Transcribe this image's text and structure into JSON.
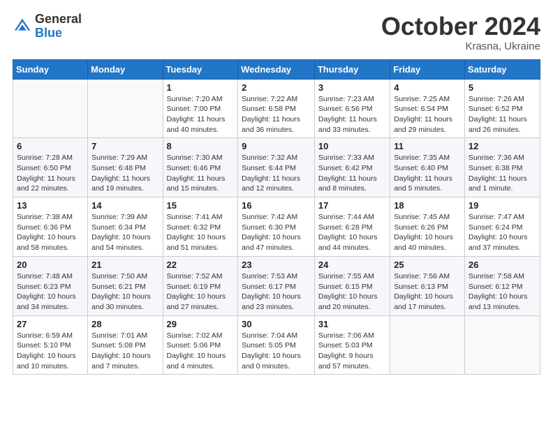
{
  "header": {
    "logo_general": "General",
    "logo_blue": "Blue",
    "title": "October 2024",
    "location": "Krasna, Ukraine"
  },
  "weekdays": [
    "Sunday",
    "Monday",
    "Tuesday",
    "Wednesday",
    "Thursday",
    "Friday",
    "Saturday"
  ],
  "weeks": [
    [
      {
        "day": "",
        "sunrise": "",
        "sunset": "",
        "daylight": ""
      },
      {
        "day": "",
        "sunrise": "",
        "sunset": "",
        "daylight": ""
      },
      {
        "day": "1",
        "sunrise": "Sunrise: 7:20 AM",
        "sunset": "Sunset: 7:00 PM",
        "daylight": "Daylight: 11 hours and 40 minutes."
      },
      {
        "day": "2",
        "sunrise": "Sunrise: 7:22 AM",
        "sunset": "Sunset: 6:58 PM",
        "daylight": "Daylight: 11 hours and 36 minutes."
      },
      {
        "day": "3",
        "sunrise": "Sunrise: 7:23 AM",
        "sunset": "Sunset: 6:56 PM",
        "daylight": "Daylight: 11 hours and 33 minutes."
      },
      {
        "day": "4",
        "sunrise": "Sunrise: 7:25 AM",
        "sunset": "Sunset: 6:54 PM",
        "daylight": "Daylight: 11 hours and 29 minutes."
      },
      {
        "day": "5",
        "sunrise": "Sunrise: 7:26 AM",
        "sunset": "Sunset: 6:52 PM",
        "daylight": "Daylight: 11 hours and 26 minutes."
      }
    ],
    [
      {
        "day": "6",
        "sunrise": "Sunrise: 7:28 AM",
        "sunset": "Sunset: 6:50 PM",
        "daylight": "Daylight: 11 hours and 22 minutes."
      },
      {
        "day": "7",
        "sunrise": "Sunrise: 7:29 AM",
        "sunset": "Sunset: 6:48 PM",
        "daylight": "Daylight: 11 hours and 19 minutes."
      },
      {
        "day": "8",
        "sunrise": "Sunrise: 7:30 AM",
        "sunset": "Sunset: 6:46 PM",
        "daylight": "Daylight: 11 hours and 15 minutes."
      },
      {
        "day": "9",
        "sunrise": "Sunrise: 7:32 AM",
        "sunset": "Sunset: 6:44 PM",
        "daylight": "Daylight: 11 hours and 12 minutes."
      },
      {
        "day": "10",
        "sunrise": "Sunrise: 7:33 AM",
        "sunset": "Sunset: 6:42 PM",
        "daylight": "Daylight: 11 hours and 8 minutes."
      },
      {
        "day": "11",
        "sunrise": "Sunrise: 7:35 AM",
        "sunset": "Sunset: 6:40 PM",
        "daylight": "Daylight: 11 hours and 5 minutes."
      },
      {
        "day": "12",
        "sunrise": "Sunrise: 7:36 AM",
        "sunset": "Sunset: 6:38 PM",
        "daylight": "Daylight: 11 hours and 1 minute."
      }
    ],
    [
      {
        "day": "13",
        "sunrise": "Sunrise: 7:38 AM",
        "sunset": "Sunset: 6:36 PM",
        "daylight": "Daylight: 10 hours and 58 minutes."
      },
      {
        "day": "14",
        "sunrise": "Sunrise: 7:39 AM",
        "sunset": "Sunset: 6:34 PM",
        "daylight": "Daylight: 10 hours and 54 minutes."
      },
      {
        "day": "15",
        "sunrise": "Sunrise: 7:41 AM",
        "sunset": "Sunset: 6:32 PM",
        "daylight": "Daylight: 10 hours and 51 minutes."
      },
      {
        "day": "16",
        "sunrise": "Sunrise: 7:42 AM",
        "sunset": "Sunset: 6:30 PM",
        "daylight": "Daylight: 10 hours and 47 minutes."
      },
      {
        "day": "17",
        "sunrise": "Sunrise: 7:44 AM",
        "sunset": "Sunset: 6:28 PM",
        "daylight": "Daylight: 10 hours and 44 minutes."
      },
      {
        "day": "18",
        "sunrise": "Sunrise: 7:45 AM",
        "sunset": "Sunset: 6:26 PM",
        "daylight": "Daylight: 10 hours and 40 minutes."
      },
      {
        "day": "19",
        "sunrise": "Sunrise: 7:47 AM",
        "sunset": "Sunset: 6:24 PM",
        "daylight": "Daylight: 10 hours and 37 minutes."
      }
    ],
    [
      {
        "day": "20",
        "sunrise": "Sunrise: 7:48 AM",
        "sunset": "Sunset: 6:23 PM",
        "daylight": "Daylight: 10 hours and 34 minutes."
      },
      {
        "day": "21",
        "sunrise": "Sunrise: 7:50 AM",
        "sunset": "Sunset: 6:21 PM",
        "daylight": "Daylight: 10 hours and 30 minutes."
      },
      {
        "day": "22",
        "sunrise": "Sunrise: 7:52 AM",
        "sunset": "Sunset: 6:19 PM",
        "daylight": "Daylight: 10 hours and 27 minutes."
      },
      {
        "day": "23",
        "sunrise": "Sunrise: 7:53 AM",
        "sunset": "Sunset: 6:17 PM",
        "daylight": "Daylight: 10 hours and 23 minutes."
      },
      {
        "day": "24",
        "sunrise": "Sunrise: 7:55 AM",
        "sunset": "Sunset: 6:15 PM",
        "daylight": "Daylight: 10 hours and 20 minutes."
      },
      {
        "day": "25",
        "sunrise": "Sunrise: 7:56 AM",
        "sunset": "Sunset: 6:13 PM",
        "daylight": "Daylight: 10 hours and 17 minutes."
      },
      {
        "day": "26",
        "sunrise": "Sunrise: 7:58 AM",
        "sunset": "Sunset: 6:12 PM",
        "daylight": "Daylight: 10 hours and 13 minutes."
      }
    ],
    [
      {
        "day": "27",
        "sunrise": "Sunrise: 6:59 AM",
        "sunset": "Sunset: 5:10 PM",
        "daylight": "Daylight: 10 hours and 10 minutes."
      },
      {
        "day": "28",
        "sunrise": "Sunrise: 7:01 AM",
        "sunset": "Sunset: 5:08 PM",
        "daylight": "Daylight: 10 hours and 7 minutes."
      },
      {
        "day": "29",
        "sunrise": "Sunrise: 7:02 AM",
        "sunset": "Sunset: 5:06 PM",
        "daylight": "Daylight: 10 hours and 4 minutes."
      },
      {
        "day": "30",
        "sunrise": "Sunrise: 7:04 AM",
        "sunset": "Sunset: 5:05 PM",
        "daylight": "Daylight: 10 hours and 0 minutes."
      },
      {
        "day": "31",
        "sunrise": "Sunrise: 7:06 AM",
        "sunset": "Sunset: 5:03 PM",
        "daylight": "Daylight: 9 hours and 57 minutes."
      },
      {
        "day": "",
        "sunrise": "",
        "sunset": "",
        "daylight": ""
      },
      {
        "day": "",
        "sunrise": "",
        "sunset": "",
        "daylight": ""
      }
    ]
  ]
}
